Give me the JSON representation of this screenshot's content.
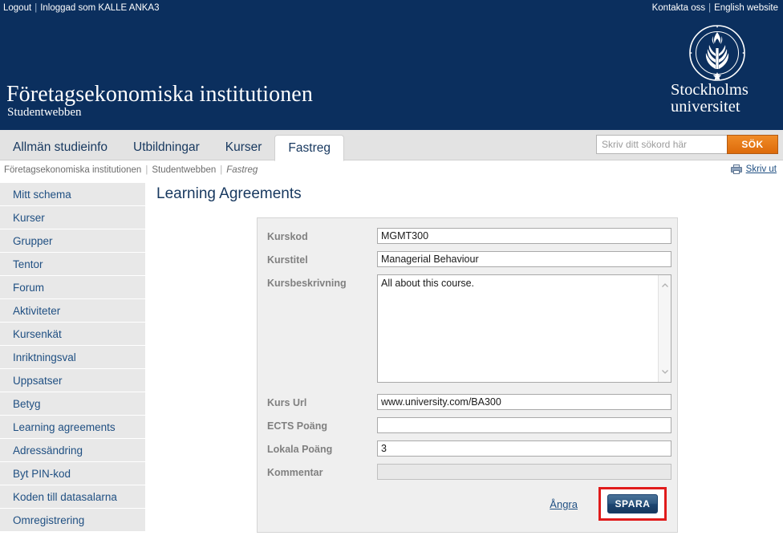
{
  "topbar": {
    "logout": "Logout",
    "separator": "|",
    "logged_in_as": "Inloggad som KALLE ANKA3",
    "contact": "Kontakta oss",
    "english": "English website"
  },
  "header": {
    "site_title": "Företagsekonomiska institutionen",
    "site_subtitle": "Studentwebben",
    "logo_line1": "Stockholms",
    "logo_line2": "universitet",
    "logo_name": "stockholm-university-seal",
    "brand_color": "#0b2f5e"
  },
  "nav": {
    "tabs": [
      {
        "label": "Allmän studieinfo",
        "active": false
      },
      {
        "label": "Utbildningar",
        "active": false
      },
      {
        "label": "Kurser",
        "active": false
      },
      {
        "label": "Fastreg",
        "active": true
      }
    ]
  },
  "search": {
    "value": "",
    "placeholder": "Skriv ditt sökord här",
    "button_label": "SÖK",
    "button_color": "#dd6b0b"
  },
  "breadcrumb": {
    "items": [
      "Företagsekonomiska institutionen",
      "Studentwebben"
    ],
    "current": "Fastreg",
    "separator": "|"
  },
  "print": {
    "label": "Skriv ut",
    "icon": "printer-icon"
  },
  "sidebar": {
    "items": [
      {
        "label": "Mitt schema"
      },
      {
        "label": "Kurser"
      },
      {
        "label": "Grupper"
      },
      {
        "label": "Tentor"
      },
      {
        "label": "Forum"
      },
      {
        "label": "Aktiviteter"
      },
      {
        "label": "Kursenkät"
      },
      {
        "label": "Inriktningsval"
      },
      {
        "label": "Uppsatser"
      },
      {
        "label": "Betyg"
      },
      {
        "label": "Learning agreements"
      },
      {
        "label": "Adressändring"
      },
      {
        "label": "Byt PIN-kod"
      },
      {
        "label": "Koden till datasalarna"
      },
      {
        "label": "Omregistrering"
      }
    ]
  },
  "main": {
    "page_title": "Learning Agreements",
    "form": {
      "fields": [
        {
          "label": "Kurskod",
          "value": "MGMT300",
          "type": "text",
          "disabled": false
        },
        {
          "label": "Kurstitel",
          "value": "Managerial Behaviour",
          "type": "text",
          "disabled": false
        },
        {
          "label": "Kursbeskrivning",
          "value": "All about this course.",
          "type": "textarea",
          "disabled": false
        },
        {
          "label": "Kurs Url",
          "value": "www.university.com/BA300",
          "type": "text",
          "disabled": false
        },
        {
          "label": "ECTS Poäng",
          "value": "",
          "type": "text",
          "disabled": false
        },
        {
          "label": "Lokala Poäng",
          "value": "3",
          "type": "text",
          "disabled": false
        },
        {
          "label": "Kommentar",
          "value": "",
          "type": "text",
          "disabled": true
        }
      ],
      "cancel_label": "Ångra",
      "save_label": "SPARA",
      "highlight_color": "#e01b1b"
    }
  }
}
